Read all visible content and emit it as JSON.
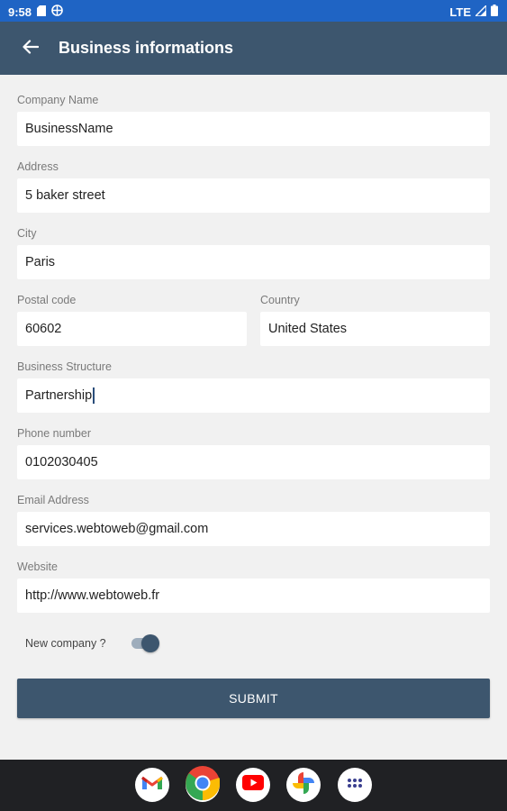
{
  "status_bar": {
    "time": "9:58",
    "network": "LTE"
  },
  "app_bar": {
    "title": "Business informations"
  },
  "form": {
    "company_name": {
      "label": "Company Name",
      "value": "BusinessName"
    },
    "address": {
      "label": "Address",
      "value": "5 baker street"
    },
    "city": {
      "label": "City",
      "value": "Paris"
    },
    "postal_code": {
      "label": "Postal code",
      "value": "60602"
    },
    "country": {
      "label": "Country",
      "value": "United States"
    },
    "business_structure": {
      "label": "Business Structure",
      "value": "Partnership"
    },
    "phone": {
      "label": "Phone number",
      "value": "0102030405"
    },
    "email": {
      "label": "Email Address",
      "value": "services.webtoweb@gmail.com"
    },
    "website": {
      "label": "Website",
      "value": "http://www.webtoweb.fr"
    },
    "new_company": {
      "label": "New company ?",
      "checked": true
    },
    "submit_label": "SUBMIT"
  },
  "dock": {
    "apps": [
      "gmail-icon",
      "chrome-icon",
      "youtube-icon",
      "photos-icon",
      "app-drawer-icon"
    ]
  },
  "colors": {
    "status_bar": "#1f64c4",
    "primary": "#3d566e",
    "background": "#f1f1f1",
    "dock": "#202124"
  }
}
